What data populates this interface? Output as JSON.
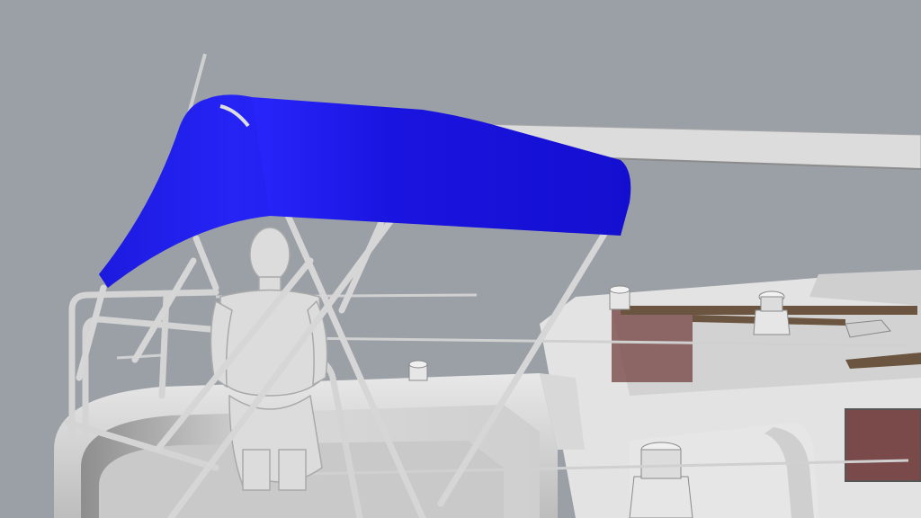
{
  "scene": {
    "background_color": "#9aa0a6",
    "bimini_color": "#1a14e0",
    "hull_color": "#e2e2e2",
    "hull_shadow": "#b9b9b9",
    "window_color": "#7a4a4a",
    "deck_wood": "#6b5540",
    "frame_color": "#d6d6d6",
    "figure_color": "#dcdcdc"
  }
}
